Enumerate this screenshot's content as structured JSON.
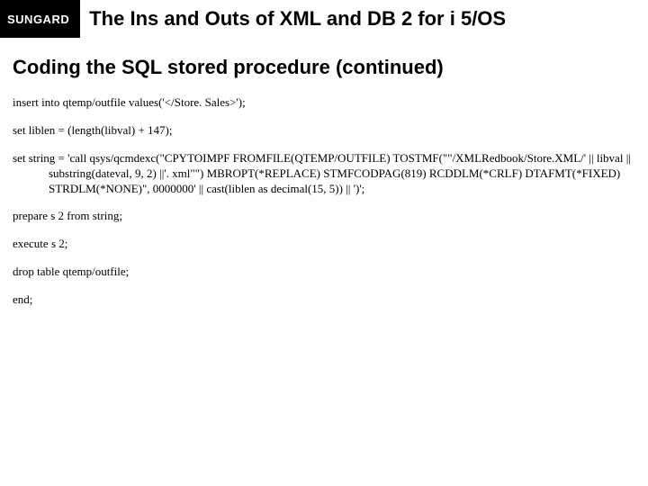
{
  "header": {
    "logo": "SUNGARD",
    "title": "The Ins and Outs of XML and DB 2 for i 5/OS"
  },
  "subtitle": "Coding the SQL stored procedure (continued)",
  "code": {
    "line1": "insert into qtemp/outfile values('</Store. Sales>');",
    "line2": "set liblen = (length(libval) + 147);",
    "line3a": "set string = 'call qsys/qcmdexc(\"CPYTOIMPF FROMFILE(QTEMP/OUTFILE) TOSTMF(\"\"/XMLRedbook/Store.XML/' || libval ||",
    "line3b": "substring(dateval, 9, 2) ||'. xml\"\") MBROPT(*REPLACE) STMFCODPAG(819) RCDDLM(*CRLF) DTAFMT(*FIXED) STRDLM(*NONE)\", 0000000' || cast(liblen as decimal(15, 5)) || ')';",
    "line4": "prepare s 2 from string;",
    "line5": "execute s 2;",
    "line6": "drop table qtemp/outfile;",
    "line7": "end;"
  }
}
